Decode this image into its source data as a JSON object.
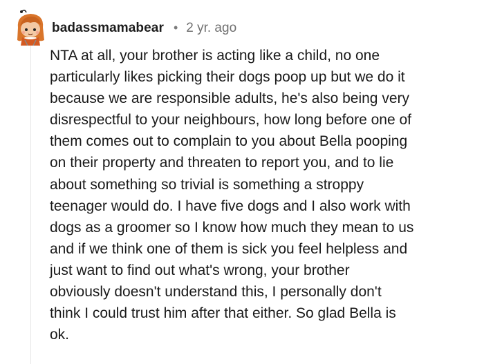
{
  "comment": {
    "author": "badassmamabear",
    "separator": "•",
    "timestamp": "2 yr. ago",
    "avatar_icon": "snoo-avatar-icon",
    "body": "NTA at all, your brother is acting like a child, no one\nparticularly likes picking their dogs poop up but we do it\nbecause we are responsible adults, he's also being very\ndisrespectful to your neighbours, how long before one of\nthem comes out to complain to you about Bella pooping\non their property and threaten to report you, and to lie\nabout something so trivial is something a stroppy\nteenager would do. I have five dogs and I also work with\ndogs as a groomer so I know how much they mean to us\nand if we think one of them is sick you feel helpless and\njust want to find out what's wrong, your brother\nobviously doesn't understand this, I personally don't\nthink I could trust him after that either. So glad Bella is\nok."
  },
  "colors": {
    "username": "#1c1c1c",
    "timestamp": "#707070",
    "body": "#1a1a1a",
    "thread_line": "#e6e6e6",
    "avatar_hair": "#d9752b",
    "avatar_face": "#f3c9a4"
  }
}
